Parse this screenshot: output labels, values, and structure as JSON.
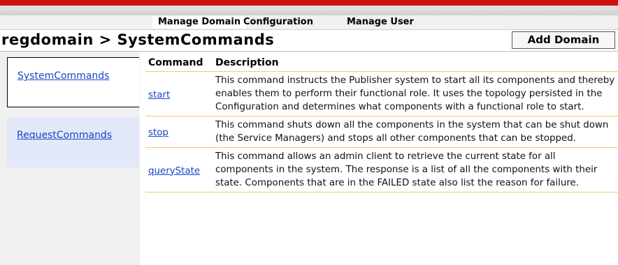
{
  "nav": {
    "tabs": [
      {
        "label": "Manage Domain"
      },
      {
        "label": "Configuration"
      },
      {
        "label": "Manage User"
      }
    ]
  },
  "header": {
    "title": "regdomain > SystemCommands",
    "add_button": "Add Domain"
  },
  "sidebar": {
    "items": [
      {
        "label": "SystemCommands"
      },
      {
        "label": "RequestCommands"
      }
    ]
  },
  "table": {
    "headers": {
      "command": "Command",
      "description": "Description"
    },
    "rows": [
      {
        "command": "start",
        "description": "This command instructs the Publisher system to start all its components and thereby enables them to perform their functional role. It uses the topology persisted in the Configuration and determines what components with a functional role to start."
      },
      {
        "command": "stop",
        "description": "This command shuts down all the components in the system that can be shut down (the Service Managers) and stops all other components that can be stopped."
      },
      {
        "command": "queryState",
        "description": "This command allows an admin client to retrieve the current state for all components in the system. The response is a list of all the components with their state. Components that are in the FAILED state also list the reason for failure."
      }
    ]
  }
}
